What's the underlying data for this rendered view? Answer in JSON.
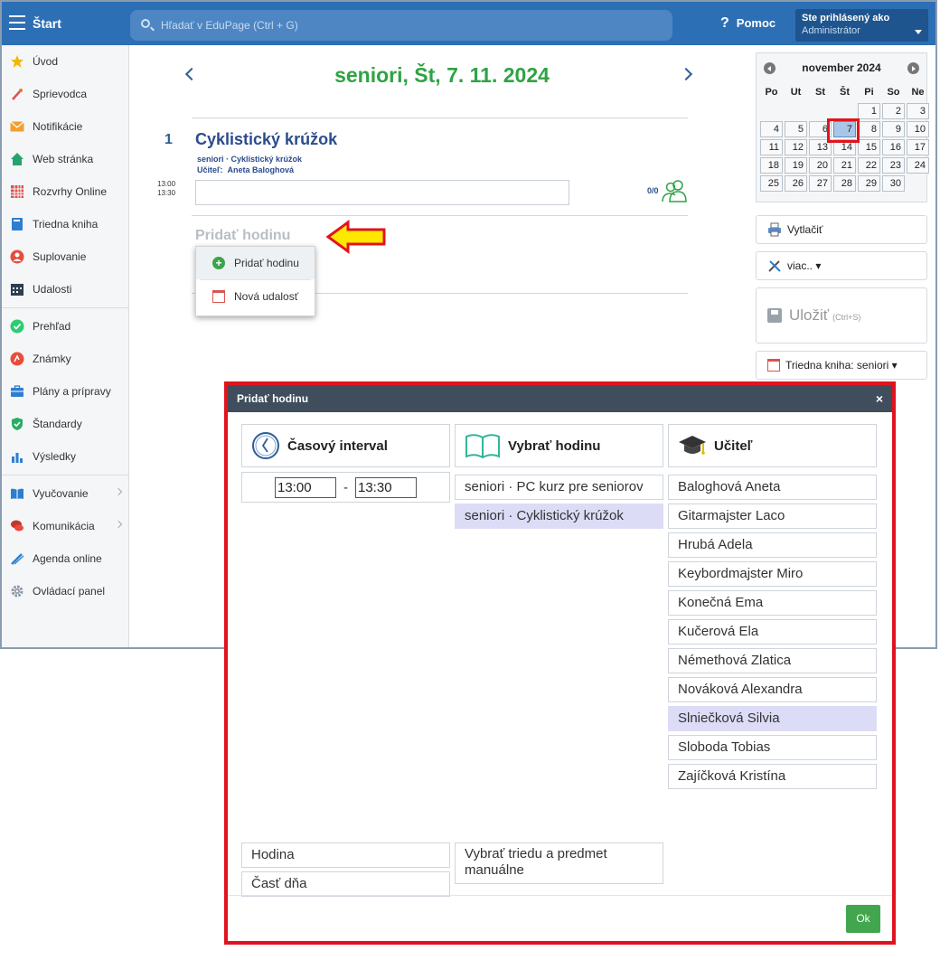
{
  "topbar": {
    "start_label": "Štart",
    "search_placeholder": "Hľadať v EduPage (Ctrl + G)",
    "help_label": "Pomoc",
    "user_line1": "Ste prihlásený ako",
    "user_line2": "Administrátor"
  },
  "sidebar": {
    "items": [
      {
        "label": "Úvod"
      },
      {
        "label": "Sprievodca"
      },
      {
        "label": "Notifikácie"
      },
      {
        "label": "Web stránka"
      },
      {
        "label": "Rozvrhy Online"
      },
      {
        "label": "Triedna kniha"
      },
      {
        "label": "Suplovanie"
      },
      {
        "label": "Udalosti"
      },
      {
        "label": "Prehľad"
      },
      {
        "label": "Známky"
      },
      {
        "label": "Plány a prípravy"
      },
      {
        "label": "Štandardy"
      },
      {
        "label": "Výsledky"
      },
      {
        "label": "Vyučovanie"
      },
      {
        "label": "Komunikácia"
      },
      {
        "label": "Agenda online"
      },
      {
        "label": "Ovládací panel"
      }
    ]
  },
  "main": {
    "date_title": "seniori, Št, 7. 11. 2024",
    "lesson": {
      "number": "1",
      "title": "Cyklistický krúžok",
      "subtitle": "seniori · Cyklistický krúžok",
      "teacher_label": "Učiteľ:",
      "teacher_name": "Aneta Baloghová",
      "time_start": "13:00",
      "time_end": "13:30",
      "attendance": "0/0"
    },
    "add_lesson": "Pridať hodinu",
    "context_menu": {
      "add_lesson": "Pridať hodinu",
      "new_event": "Nová udalosť"
    }
  },
  "calendar": {
    "month": "november 2024",
    "dow": [
      "Po",
      "Ut",
      "St",
      "Št",
      "Pi",
      "So",
      "Ne"
    ],
    "leading_blanks": 4,
    "days": [
      "1",
      "2",
      "3",
      "4",
      "5",
      "6",
      "7",
      "8",
      "9",
      "10",
      "11",
      "12",
      "13",
      "14",
      "15",
      "16",
      "17",
      "18",
      "19",
      "20",
      "21",
      "22",
      "23",
      "24",
      "25",
      "26",
      "27",
      "28",
      "29",
      "30"
    ],
    "selected": "7"
  },
  "right_buttons": {
    "print": "Vytlačiť",
    "more": "viac.. ▾",
    "save": "Uložiť",
    "save_shortcut": "(Ctrl+S)",
    "classbook": "Triedna kniha: seniori ▾"
  },
  "dialog": {
    "title": "Pridať hodinu",
    "close": "×",
    "col_time": "Časový interval",
    "col_lesson": "Vybrať hodinu",
    "col_teacher": "Učiteľ",
    "time_from": "13:00",
    "time_to": "13:30",
    "time_dash": "-",
    "lessons": [
      {
        "label": "seniori · PC kurz pre seniorov",
        "selected": false
      },
      {
        "label": "seniori · Cyklistický krúžok",
        "selected": true
      }
    ],
    "teachers": [
      {
        "label": "Baloghová Aneta",
        "selected": false
      },
      {
        "label": "Gitarmajster Laco",
        "selected": false
      },
      {
        "label": "Hrubá Adela",
        "selected": false
      },
      {
        "label": "Keybordmajster Miro",
        "selected": false
      },
      {
        "label": "Konečná Ema",
        "selected": false
      },
      {
        "label": "Kučerová Ela",
        "selected": false
      },
      {
        "label": "Némethová Zlatica",
        "selected": false
      },
      {
        "label": "Nováková Alexandra",
        "selected": false
      },
      {
        "label": "Slniečková Silvia",
        "selected": true
      },
      {
        "label": "Sloboda Tobias",
        "selected": false
      },
      {
        "label": "Zajíčková Kristína",
        "selected": false
      }
    ],
    "bottom_hour": "Hodina",
    "bottom_daypart": "Časť dňa",
    "bottom_manual": "Vybrať triedu a predmet manuálne",
    "ok": "Ok"
  },
  "colors": {
    "topbar": "#2d6fb5",
    "title_green": "#2ea344",
    "highlight_red": "#e0141e",
    "selected_row": "#dcdcf7",
    "ok_green": "#42a64f"
  }
}
